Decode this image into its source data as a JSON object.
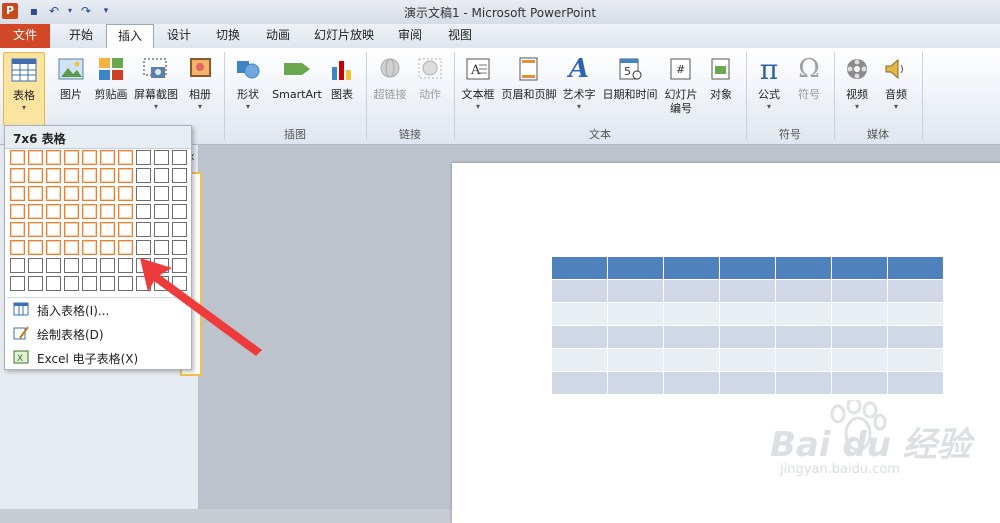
{
  "app": {
    "title": "演示文稿1 - Microsoft PowerPoint",
    "icon_letter": "P"
  },
  "qat": {
    "save_icon": "save-icon",
    "undo_icon": "undo-icon",
    "redo_icon": "redo-icon",
    "customize_icon": "customize-icon"
  },
  "tabs": [
    {
      "label": "文件"
    },
    {
      "label": "开始"
    },
    {
      "label": "插入"
    },
    {
      "label": "设计"
    },
    {
      "label": "切换"
    },
    {
      "label": "动画"
    },
    {
      "label": "幻灯片放映"
    },
    {
      "label": "审阅"
    },
    {
      "label": "视图"
    }
  ],
  "ribbon": {
    "buttons": [
      {
        "label": "表格",
        "icon": "table-icon",
        "arrow": "▾"
      },
      {
        "label": "图片",
        "icon": "picture-icon"
      },
      {
        "label": "剪贴画",
        "icon": "clipart-icon"
      },
      {
        "label": "屏幕截图",
        "icon": "screenshot-icon",
        "arrow": "▾"
      },
      {
        "label": "相册",
        "icon": "album-icon",
        "arrow": "▾"
      },
      {
        "label": "形状",
        "icon": "shapes-icon",
        "arrow": "▾"
      },
      {
        "label": "SmartArt",
        "icon": "smartart-icon"
      },
      {
        "label": "图表",
        "icon": "chart-icon"
      },
      {
        "label": "超链接",
        "icon": "hyperlink-icon"
      },
      {
        "label": "动作",
        "icon": "action-icon"
      },
      {
        "label": "文本框",
        "icon": "textbox-icon",
        "arrow": "▾"
      },
      {
        "label": "页眉和页脚",
        "icon": "header-footer-icon"
      },
      {
        "label": "艺术字",
        "icon": "wordart-icon",
        "arrow": "▾"
      },
      {
        "label": "日期和时间",
        "icon": "datetime-icon"
      },
      {
        "label": "幻灯片",
        "label2": "编号",
        "icon": "slide-number-icon"
      },
      {
        "label": "对象",
        "icon": "object-icon"
      },
      {
        "label": "公式",
        "icon": "equation-icon",
        "arrow": "▾"
      },
      {
        "label": "符号",
        "icon": "symbol-icon"
      },
      {
        "label": "视频",
        "icon": "video-icon",
        "arrow": "▾"
      },
      {
        "label": "音频",
        "icon": "audio-icon",
        "arrow": "▾"
      }
    ],
    "groups": [
      "插图",
      "链接",
      "文本",
      "符号",
      "媒体"
    ]
  },
  "dropdown": {
    "title": "7x6 表格",
    "grid_cols": 10,
    "grid_rows": 8,
    "selected_cols": 7,
    "selected_rows": 6,
    "menu": [
      {
        "label": "插入表格(I)...",
        "icon": "insert-table-icon"
      },
      {
        "label": "绘制表格(D)",
        "icon": "draw-table-icon"
      },
      {
        "label": "Excel 电子表格(X)",
        "icon": "excel-icon"
      }
    ]
  },
  "slide_table": {
    "cols": 7,
    "rows": 6
  },
  "pane": {
    "close_glyph": "x"
  },
  "watermark": {
    "text": "Bai du 经验",
    "url": "jingyan.baidu.com"
  },
  "colors": {
    "file_tab": "#d24726",
    "selection": "#f07c2e",
    "table_header": "#4f81bd",
    "arrow": "#ee3b3b"
  }
}
